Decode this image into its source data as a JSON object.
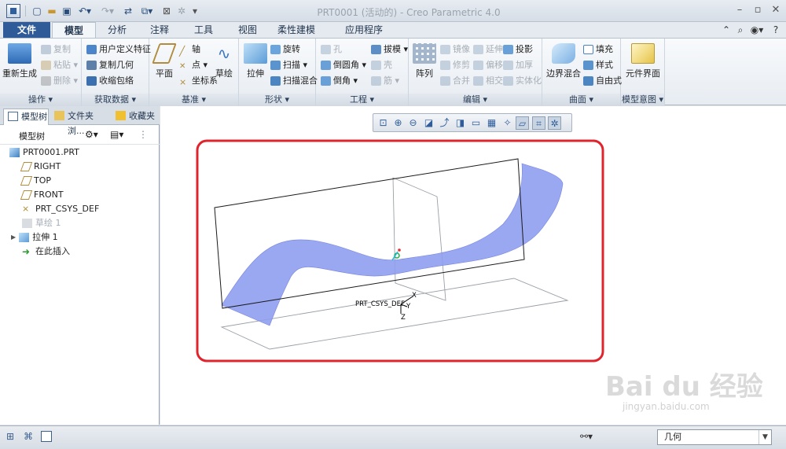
{
  "window": {
    "title": "PRT0001 (活动的) - Creo Parametric 4.0"
  },
  "ribbon_tabs": [
    "文件",
    "模型",
    "分析",
    "注释",
    "工具",
    "视图",
    "柔性建模",
    "应用程序"
  ],
  "ribbon": {
    "operations": {
      "label": "操作 ▾",
      "regenerate": "重新生成",
      "copy": "复制",
      "paste": "粘贴 ▾",
      "delete": "删除 ▾"
    },
    "get_data": {
      "label": "获取数据 ▾",
      "udf": "用户定义特征",
      "copy_geom": "复制几何",
      "shrinkwrap": "收缩包络"
    },
    "datum": {
      "label": "基准 ▾",
      "plane": "平面",
      "axis": "轴",
      "point": "点 ▾",
      "csys": "坐标系",
      "sketch": "草绘"
    },
    "shapes": {
      "label": "形状 ▾",
      "extrude": "拉伸",
      "revolve": "旋转",
      "sweep": "扫描 ▾",
      "swept_blend": "扫描混合"
    },
    "engineering": {
      "label": "工程 ▾",
      "hole": "孔",
      "draft": "拔模 ▾",
      "round": "倒圆角 ▾",
      "shell": "壳",
      "chamfer": "倒角 ▾",
      "rib": "筋 ▾"
    },
    "editing": {
      "label": "编辑 ▾",
      "pattern": "阵列",
      "mirror": "镜像",
      "extend": "延伸",
      "project": "投影",
      "trim": "修剪",
      "offset": "偏移",
      "thicken": "加厚",
      "merge": "合并",
      "intersect": "相交",
      "solidify": "实体化"
    },
    "surfaces": {
      "label": "曲面 ▾",
      "boundary_blend": "边界混合",
      "fill": "填充",
      "style": "样式",
      "freestyle": "自由式"
    },
    "model_intent": {
      "label": "模型意图 ▾",
      "component_interface": "元件界面"
    }
  },
  "left_panel": {
    "tabs": [
      "模型树",
      "文件夹浏...",
      "收藏夹"
    ],
    "tree_header": "模型树",
    "nodes": [
      "PRT0001.PRT",
      "RIGHT",
      "TOP",
      "FRONT",
      "PRT_CSYS_DEF",
      "草绘 1",
      "拉伸 1",
      "在此插入"
    ]
  },
  "graphics": {
    "csys_label": "PRT_CSYS_DEF",
    "axis_x": "X",
    "axis_y": "Y",
    "axis_z": "Z"
  },
  "status_bar": {
    "filter_value": "几何"
  },
  "watermark": {
    "text": "Bai du 经验",
    "url": "jingyan.baidu.com"
  },
  "colors": {
    "file_tab": "#2f5c98",
    "surface": "#8f9df0",
    "highlight_frame": "#e0242d"
  }
}
